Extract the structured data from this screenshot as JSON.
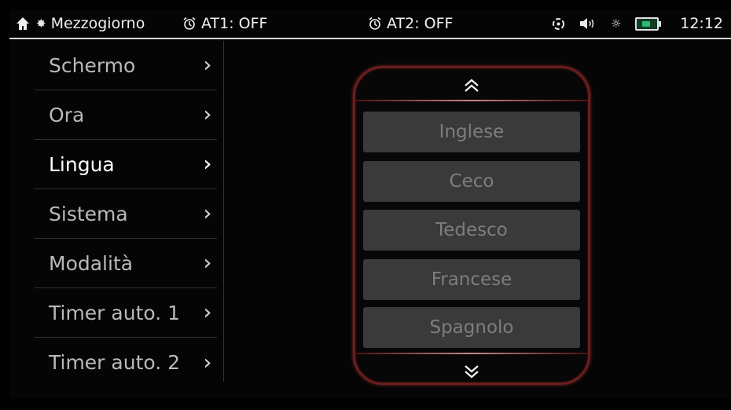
{
  "status": {
    "daypart": "Mezzogiorno",
    "timer1": "AT1: OFF",
    "timer2": "AT2: OFF",
    "time": "12:12"
  },
  "icons": {
    "home": "home-icon",
    "daypart": "sun-icon",
    "alarm": "alarm-clock-icon",
    "brightness": "brightness-icon",
    "speaker": "speaker-icon",
    "battery": "battery-icon",
    "chevron": "double-chevron-right-icon"
  },
  "menu": {
    "items": [
      {
        "label": "Schermo"
      },
      {
        "label": "Ora"
      },
      {
        "label": "Lingua"
      },
      {
        "label": "Sistema"
      },
      {
        "label": "Modalità"
      },
      {
        "label": "Timer auto. 1"
      },
      {
        "label": "Timer auto. 2"
      }
    ],
    "selected": "Lingua"
  },
  "language_picker": {
    "options": [
      "Inglese",
      "Ceco",
      "Tedesco",
      "Francese",
      "Spagnolo"
    ]
  },
  "colors": {
    "frame": "#6a1d1d",
    "option_bg": "#3a3a3a",
    "option_text": "#7e7e7e",
    "battery": "#2eb872"
  }
}
